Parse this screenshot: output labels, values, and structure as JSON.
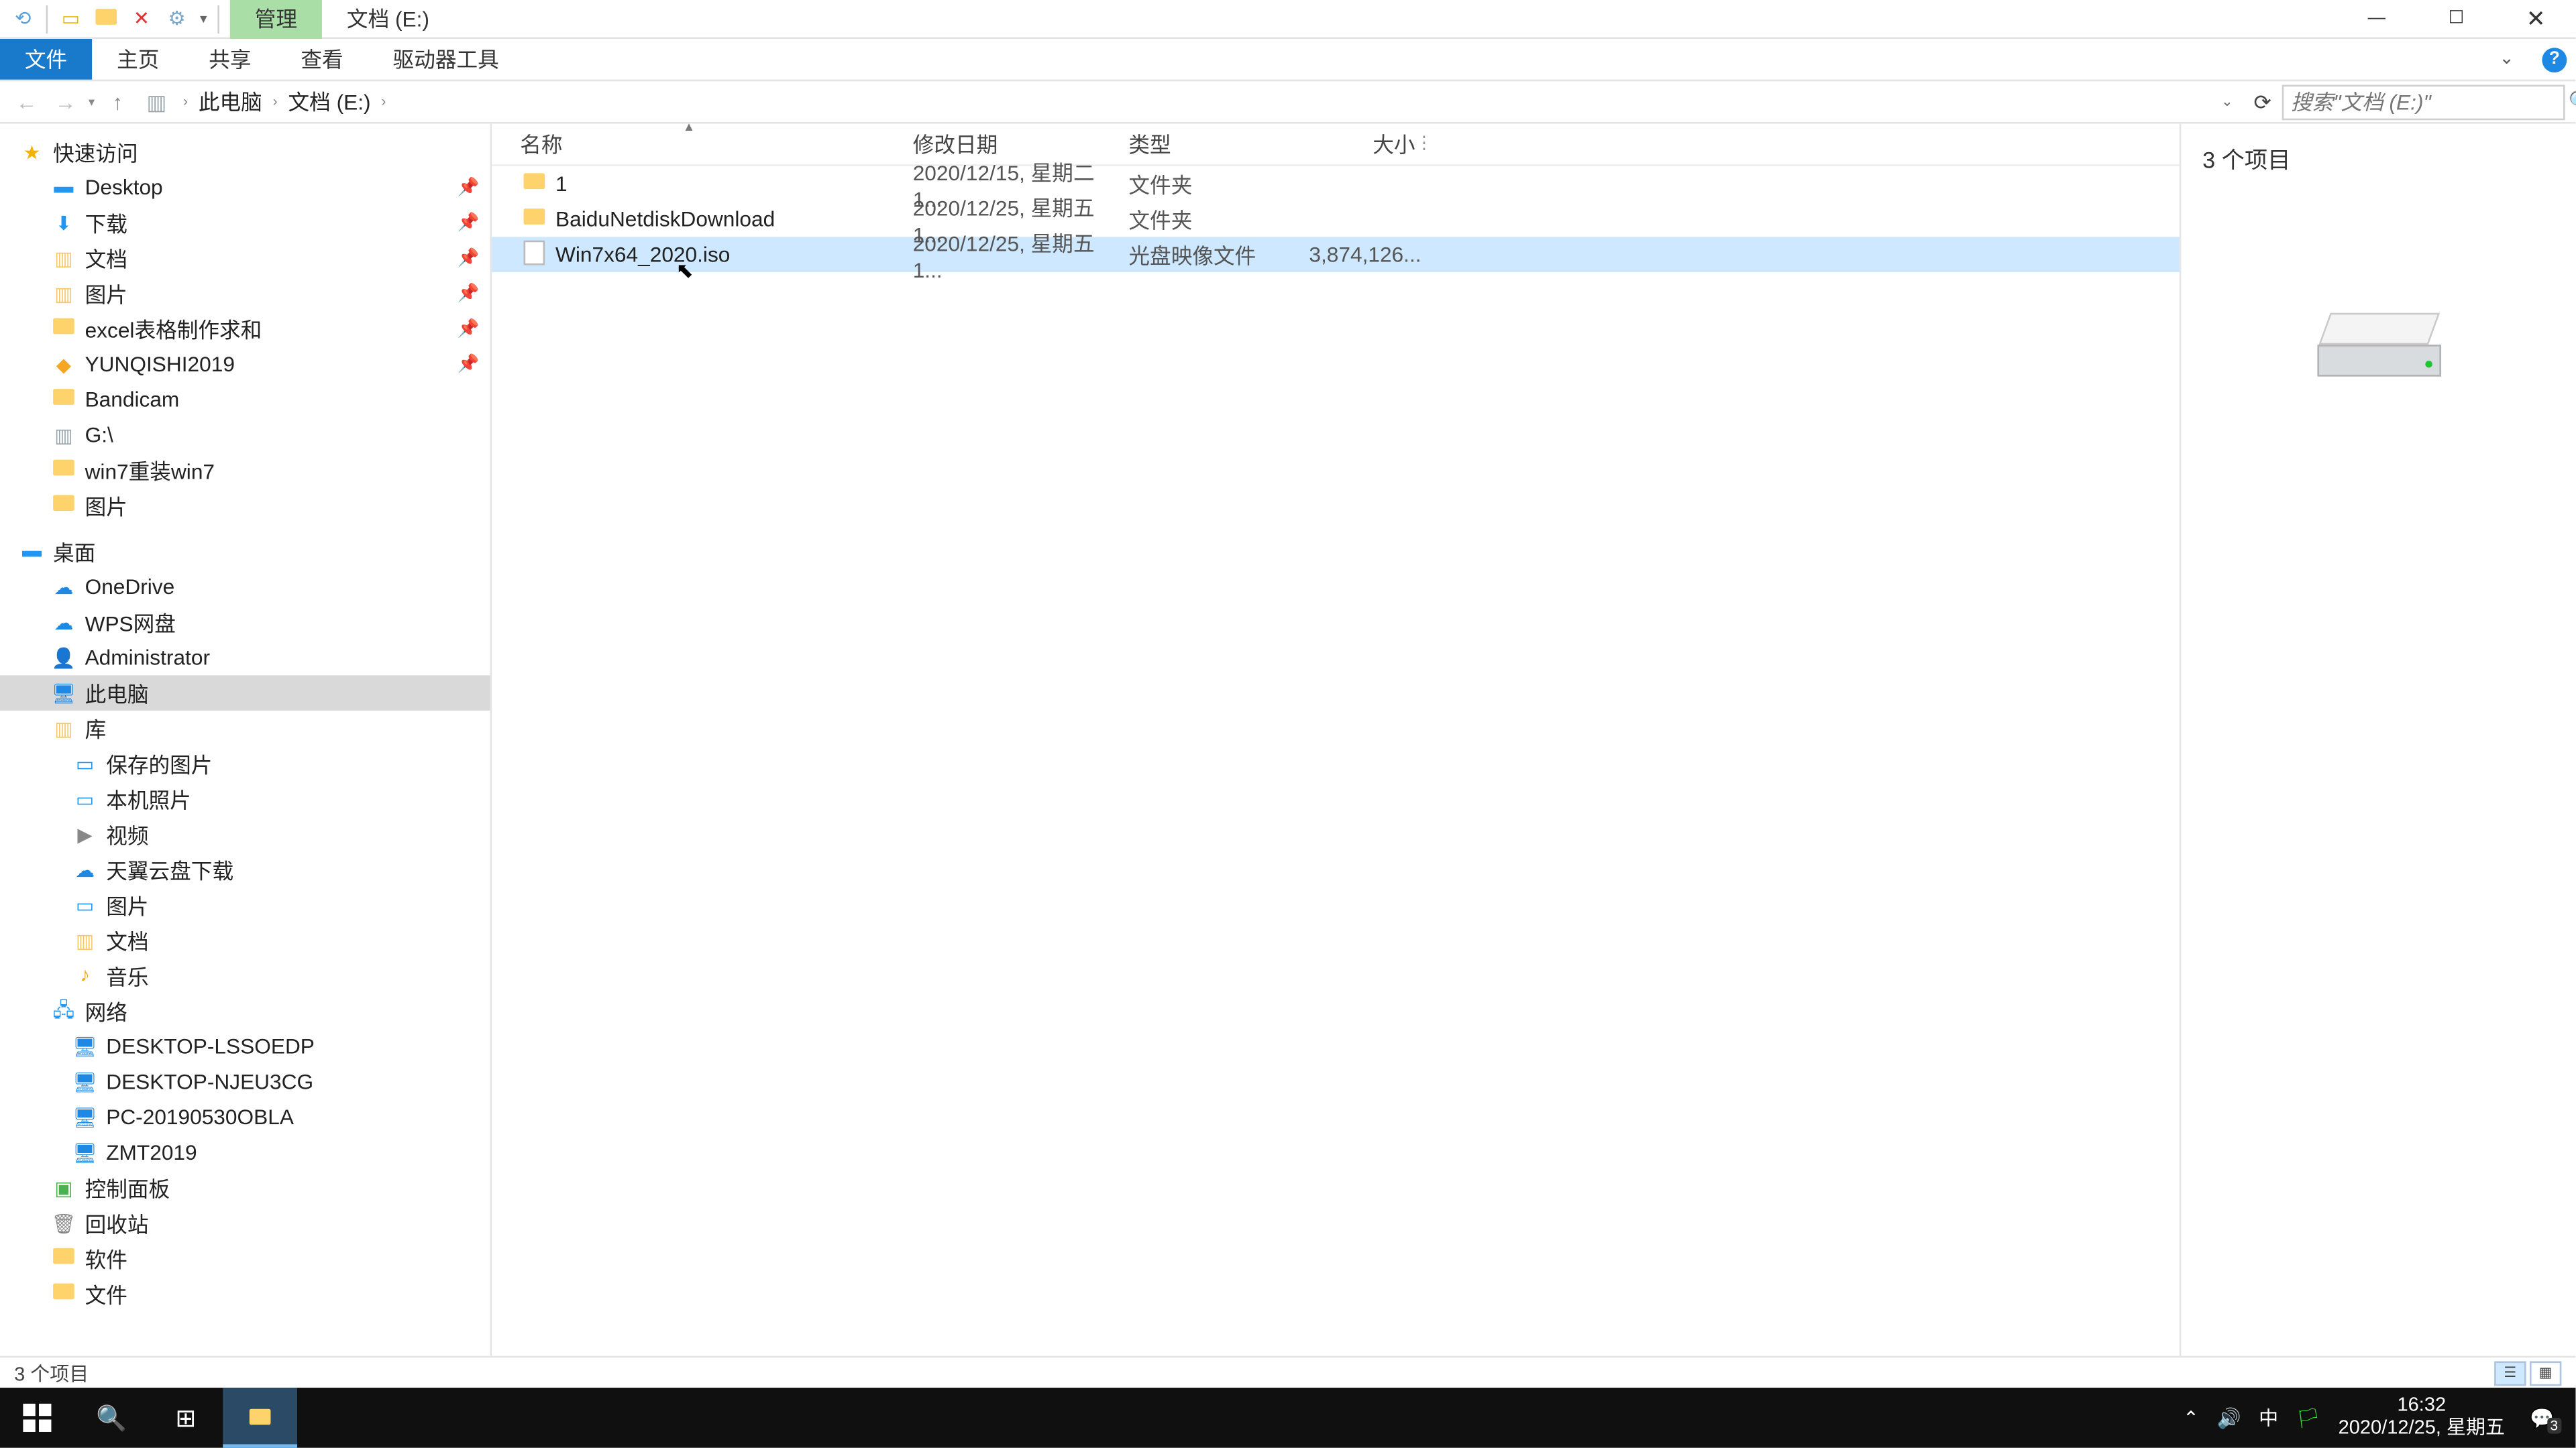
{
  "titlebar": {
    "context_tab": "管理",
    "window_title": "文档 (E:)"
  },
  "ribbon": {
    "file": "文件",
    "tabs": [
      "主页",
      "共享",
      "查看",
      "驱动器工具"
    ]
  },
  "breadcrumbs": [
    "此电脑",
    "文档 (E:)"
  ],
  "search": {
    "placeholder": "搜索\"文档 (E:)\""
  },
  "tree": {
    "quick_access": "快速访问",
    "qa_items": [
      {
        "name": "Desktop",
        "icon": "desktop",
        "pinned": true
      },
      {
        "name": "下载",
        "icon": "download",
        "pinned": true
      },
      {
        "name": "文档",
        "icon": "docs",
        "pinned": true
      },
      {
        "name": "图片",
        "icon": "pics",
        "pinned": true
      },
      {
        "name": "excel表格制作求和",
        "icon": "folder",
        "pinned": true
      },
      {
        "name": "YUNQISHI2019",
        "icon": "app",
        "pinned": true
      },
      {
        "name": "Bandicam",
        "icon": "folder",
        "pinned": false
      },
      {
        "name": "G:\\",
        "icon": "drive",
        "pinned": false
      },
      {
        "name": "win7重装win7",
        "icon": "folder",
        "pinned": false
      },
      {
        "name": "图片",
        "icon": "folder",
        "pinned": false
      }
    ],
    "desktop": "桌面",
    "desktop_items": [
      {
        "name": "OneDrive",
        "icon": "onedrive"
      },
      {
        "name": "WPS网盘",
        "icon": "wps"
      },
      {
        "name": "Administrator",
        "icon": "user"
      },
      {
        "name": "此电脑",
        "icon": "pc",
        "selected": true
      },
      {
        "name": "库",
        "icon": "lib"
      }
    ],
    "lib_items": [
      {
        "name": "保存的图片",
        "icon": "pic"
      },
      {
        "name": "本机照片",
        "icon": "pic"
      },
      {
        "name": "视频",
        "icon": "video"
      },
      {
        "name": "天翼云盘下载",
        "icon": "cloud"
      },
      {
        "name": "图片",
        "icon": "pic"
      },
      {
        "name": "文档",
        "icon": "docs"
      },
      {
        "name": "音乐",
        "icon": "music"
      }
    ],
    "network": "网络",
    "net_items": [
      {
        "name": "DESKTOP-LSSOEDP"
      },
      {
        "name": "DESKTOP-NJEU3CG"
      },
      {
        "name": "PC-20190530OBLA"
      },
      {
        "name": "ZMT2019"
      }
    ],
    "extra": [
      {
        "name": "控制面板",
        "icon": "cpl"
      },
      {
        "name": "回收站",
        "icon": "bin"
      },
      {
        "name": "软件",
        "icon": "folder"
      },
      {
        "name": "文件",
        "icon": "folder"
      }
    ]
  },
  "columns": {
    "name": "名称",
    "date": "修改日期",
    "type": "类型",
    "size": "大小"
  },
  "files": [
    {
      "icon": "folder",
      "name": "1",
      "date": "2020/12/15, 星期二 1...",
      "type": "文件夹",
      "size": ""
    },
    {
      "icon": "folder",
      "name": "BaiduNetdiskDownload",
      "date": "2020/12/25, 星期五 1...",
      "type": "文件夹",
      "size": ""
    },
    {
      "icon": "disc",
      "name": "Win7x64_2020.iso",
      "date": "2020/12/25, 星期五 1...",
      "type": "光盘映像文件",
      "size": "3,874,126...",
      "selected": true
    }
  ],
  "preview": {
    "count": "3 个项目"
  },
  "status": {
    "items": "3 个项目"
  },
  "tray": {
    "ime": "中",
    "time": "16:32",
    "date": "2020/12/25, 星期五",
    "notif_count": "3"
  }
}
